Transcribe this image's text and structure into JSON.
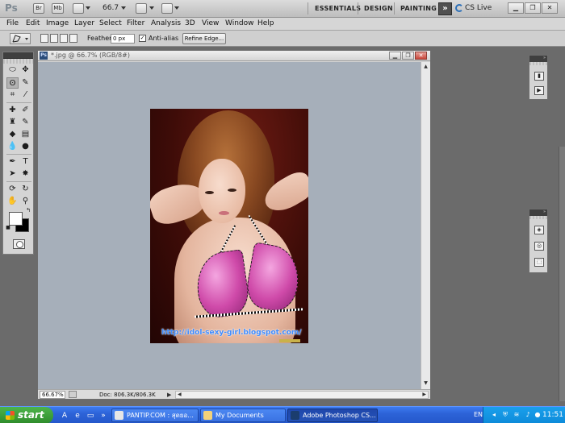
{
  "appbar": {
    "logo": "Ps",
    "bridge_label": "Br",
    "minibridge_label": "Mb",
    "zoom": "66.7",
    "workspaces": [
      "ESSENTIALS",
      "DESIGN",
      "PAINTING"
    ],
    "more_label": "»",
    "cslive_label": "CS Live",
    "window_buttons": [
      "▁",
      "❐",
      "✕"
    ]
  },
  "menu": [
    "File",
    "Edit",
    "Image",
    "Layer",
    "Select",
    "Filter",
    "Analysis",
    "3D",
    "View",
    "Window",
    "Help"
  ],
  "options": {
    "feather_label": "Feather:",
    "feather_value": "0 px",
    "antialias_label": "Anti-alias",
    "antialias_checked": true,
    "refine_label": "Refine Edge..."
  },
  "tools": {
    "foreground_color": "#ffffff",
    "background_color": "#000000"
  },
  "document": {
    "title": "*.jpg @ 66.7% (RGB/8#)",
    "buttons": [
      "▁",
      "❐",
      "✕"
    ],
    "zoom_field": "66.67%",
    "doc_size": "Doc: 806.3K/806.3K",
    "watermark": "http://idol-sexy-girl.blogspot.com/"
  },
  "taskbar": {
    "start_label": "start",
    "tasks": [
      {
        "label": "PANTIP.COM : สุดยอ...",
        "active": false
      },
      {
        "label": "My Documents",
        "active": false
      },
      {
        "label": "Adobe Photoshop CS...",
        "active": true
      }
    ],
    "lang": "EN",
    "clock": "11:51"
  }
}
